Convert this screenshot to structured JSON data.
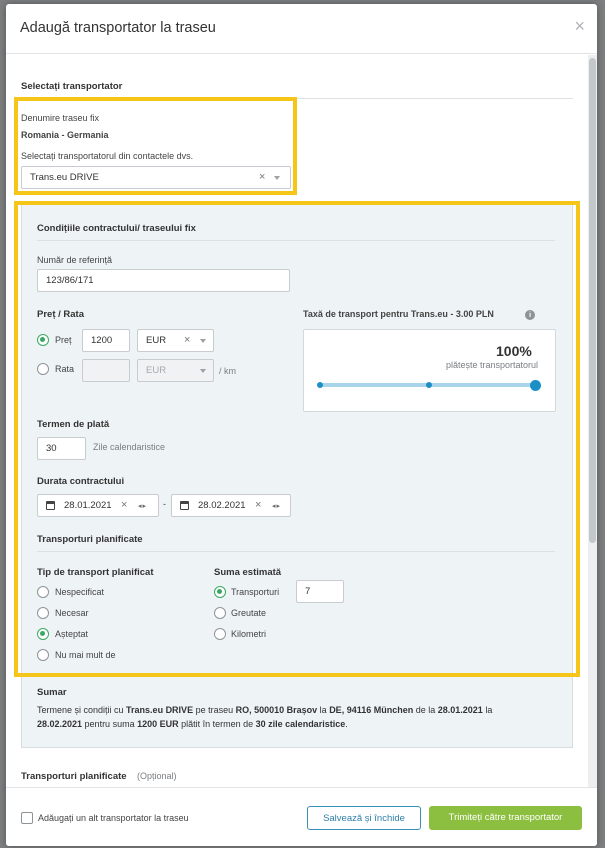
{
  "dialog": {
    "title": "Adaugă transportator la traseu",
    "close_symbol": "×"
  },
  "carrier_section": {
    "title": "Selectați transportator",
    "route_label": "Denumire traseu fix",
    "route_value": "Romania - Germania",
    "select_label": "Selectați transportatorul din contactele dvs.",
    "carrier_value": "Trans.eu DRIVE"
  },
  "contract": {
    "title": "Condițiile contractului/ traseului fix",
    "reference_label": "Număr de referință",
    "reference_value": "123/86/171",
    "price_section_label": "Preț / Rata",
    "price_option": "Preț",
    "price_value": "1200",
    "price_currency": "EUR",
    "rate_option": "Rata",
    "rate_currency_placeholder": "EUR",
    "rate_unit": "/ km",
    "payment_term_label": "Termen de plată",
    "payment_term_value": "30",
    "payment_term_unit": "Zile calendaristice",
    "duration_label": "Durata contractului",
    "date_from": "28.01.2021",
    "date_separator": "-",
    "date_to": "28.02.2021",
    "fee": {
      "label": "Taxă de transport pentru Trans.eu - 3.00 PLN",
      "percent_text": "100%",
      "payer_text": "plătește transportatorul",
      "percent": 100
    },
    "planned_title": "Transporturi planificate",
    "planned_type_label": "Tip de transport planificat",
    "planned_types": [
      "Nespecificat",
      "Necesar",
      "Așteptat",
      "Nu mai mult de"
    ],
    "planned_type_selected": "Așteptat",
    "estimate_label": "Suma estimată",
    "estimates": [
      "Transporturi",
      "Greutate",
      "Kilometri"
    ],
    "estimate_selected": "Transporturi",
    "estimate_value": "7"
  },
  "summary": {
    "title": "Sumar",
    "line1_a": "Termene și condiții cu ",
    "carrier": "Trans.eu DRIVE",
    "line1_b": " pe traseu ",
    "origin": "RO, 500010 Brașov",
    "line1_c": " la ",
    "destination": "DE, 94116 München",
    "line1_d": " de la ",
    "start": "28.01.2021",
    "line1_e": " la",
    "end": "28.02.2021",
    "line2_a": " pentru suma ",
    "amount": "1200 EUR",
    "line2_b": " plătit în termen de ",
    "term": "30 zile calendaristice",
    "line2_c": "."
  },
  "planned_section": {
    "title": "Transporturi planificate",
    "optional": "(Opțional)"
  },
  "footer": {
    "add_another_label": "Adăugați un alt transportator la traseu",
    "save_close_label": "Salvează și închide",
    "send_label": "Trimiteți către transportator"
  },
  "colors": {
    "accent_green": "#8cbf3f",
    "highlight_yellow": "#f5c518",
    "radio_green": "#3aa864",
    "slider_blue": "#1d8fc7"
  },
  "icons": [
    "close-icon",
    "info-icon",
    "calendar-icon",
    "clear-icon",
    "dropdown-caret-icon",
    "stepper-arrows-icon"
  ]
}
